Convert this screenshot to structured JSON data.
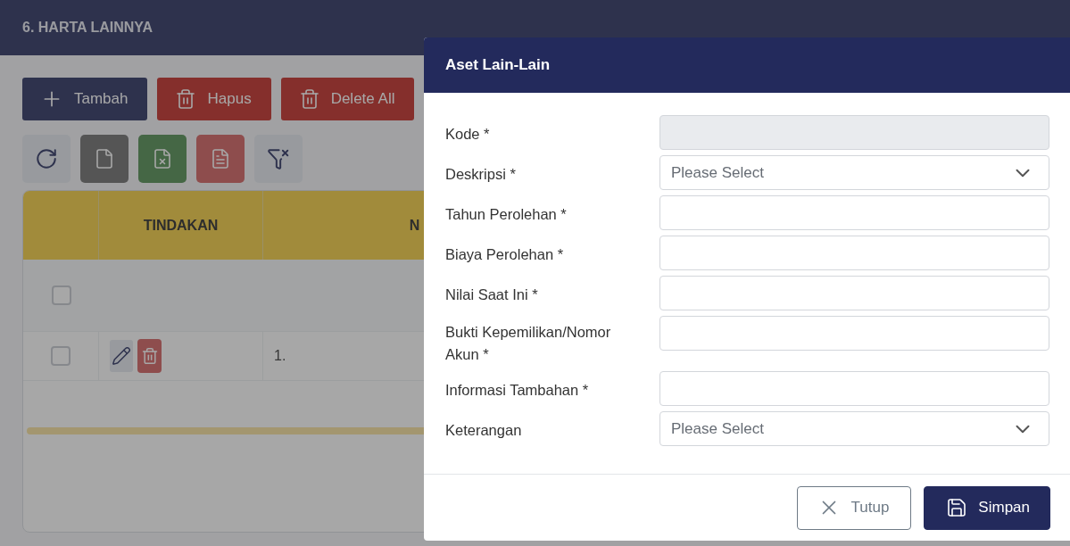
{
  "section": {
    "title": "6. HARTA LAINNYA"
  },
  "actions": [
    {
      "label": "Tambah",
      "kind": "add"
    },
    {
      "label": "Hapus",
      "kind": "delete"
    },
    {
      "label": "Delete All",
      "kind": "delete"
    }
  ],
  "tools": [
    {
      "kind": "refresh"
    },
    {
      "kind": "file"
    },
    {
      "kind": "excel"
    },
    {
      "kind": "pdf"
    },
    {
      "kind": "clear-filter"
    }
  ],
  "table": {
    "columns": [
      {
        "label": "TINDAKAN"
      },
      {
        "label": "N"
      }
    ],
    "rows": [
      {
        "kind": "filter",
        "checked": false
      },
      {
        "kind": "data",
        "checked": false,
        "number": "1."
      }
    ]
  },
  "modal": {
    "title": "Aset Lain-Lain",
    "fields": [
      {
        "label": "Kode *",
        "kind": "disabled"
      },
      {
        "label": "Deskripsi *",
        "kind": "select",
        "placeholder": "Please Select"
      },
      {
        "label": "Tahun Perolehan *",
        "kind": "text"
      },
      {
        "label": "Biaya Perolehan *",
        "kind": "text"
      },
      {
        "label": "Nilai Saat Ini *",
        "kind": "text"
      },
      {
        "label": "Bukti Kepemilikan/Nomor Akun *",
        "kind": "text"
      },
      {
        "label": "Informasi Tambahan *",
        "kind": "text"
      },
      {
        "label": "Keterangan",
        "kind": "select",
        "placeholder": "Please Select"
      }
    ],
    "buttons": [
      {
        "label": "Tutup",
        "kind": "close"
      },
      {
        "label": "Simpan",
        "kind": "save"
      }
    ]
  }
}
